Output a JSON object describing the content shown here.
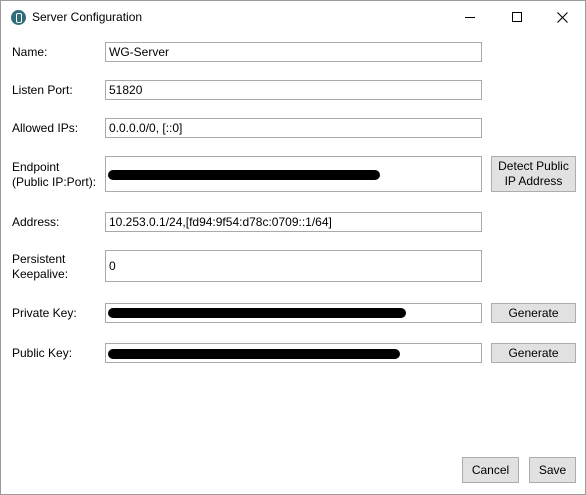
{
  "window": {
    "title": "Server Configuration"
  },
  "form": {
    "name_label": "Name:",
    "name_value": "WG-Server",
    "listen_port_label": "Listen Port:",
    "listen_port_value": "51820",
    "allowed_ips_label": "Allowed IPs:",
    "allowed_ips_value": "0.0.0.0/0, [::0]",
    "endpoint_label_line1": "Endpoint",
    "endpoint_label_line2": "(Public IP:Port):",
    "address_label": "Address:",
    "address_value": "10.253.0.1/24,[fd94:9f54:d78c:0709::1/64]",
    "keepalive_label_line1": "Persistent",
    "keepalive_label_line2": "Keepalive:",
    "keepalive_value": "0",
    "private_key_label": "Private Key:",
    "public_key_label": "Public Key:"
  },
  "buttons": {
    "detect_ip_line1": "Detect Public",
    "detect_ip_line2": "IP Address",
    "generate_private": "Generate",
    "generate_public": "Generate",
    "cancel": "Cancel",
    "save": "Save"
  },
  "icons": {
    "app": "wireguard-icon",
    "minimize": "minimize-icon",
    "maximize": "maximize-icon",
    "close": "close-icon"
  }
}
